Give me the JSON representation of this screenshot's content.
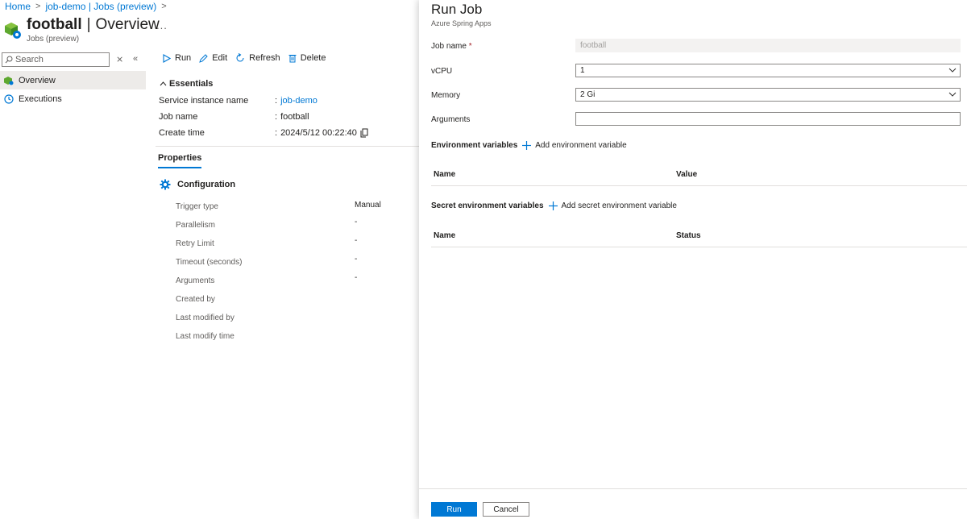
{
  "breadcrumb": {
    "home": "Home",
    "parent": "job-demo | Jobs (preview)"
  },
  "title": {
    "name": "football",
    "section": "Overview",
    "caption": "Jobs (preview)",
    "more": "..."
  },
  "sidebar": {
    "search_placeholder": "Search",
    "items": [
      {
        "label": "Overview",
        "icon": "overview-icon",
        "active": true
      },
      {
        "label": "Executions",
        "icon": "clock-icon",
        "active": false
      }
    ]
  },
  "toolbar": {
    "run": "Run",
    "edit": "Edit",
    "refresh": "Refresh",
    "delete": "Delete"
  },
  "essentials": {
    "header": "Essentials",
    "rows": [
      {
        "label": "Service instance name",
        "value": "job-demo"
      },
      {
        "label": "Job name",
        "value": "football"
      },
      {
        "label": "Create time",
        "value": "2024/5/12 00:22:40"
      }
    ]
  },
  "properties": {
    "tab": "Properties",
    "config_header": "Configuration",
    "rows": [
      {
        "label": "Trigger type",
        "value": "Manual"
      },
      {
        "label": "Parallelism",
        "value": "-"
      },
      {
        "label": "Retry Limit",
        "value": "-"
      },
      {
        "label": "Timeout (seconds)",
        "value": "-"
      },
      {
        "label": "Arguments",
        "value": "-"
      },
      {
        "label": "Created by",
        "value": ""
      },
      {
        "label": "Last modified by",
        "value": ""
      },
      {
        "label": "Last modify time",
        "value": ""
      }
    ]
  },
  "run_job": {
    "title": "Run Job",
    "subtitle": "Azure Spring Apps",
    "fields": {
      "job_name_label": "Job name",
      "job_name_required": "*",
      "job_name_value": "football",
      "vcpu_label": "vCPU",
      "vcpu_value": "1",
      "memory_label": "Memory",
      "memory_value": "2 Gi",
      "arguments_label": "Arguments",
      "arguments_value": ""
    },
    "env": {
      "header": "Environment variables",
      "add": "Add environment variable",
      "col_name": "Name",
      "col_value": "Value"
    },
    "secret_env": {
      "header": "Secret environment variables",
      "add": "Add secret environment variable",
      "col_name": "Name",
      "col_status": "Status"
    },
    "footer": {
      "run": "Run",
      "cancel": "Cancel"
    }
  },
  "colors": {
    "accent": "#0078d4",
    "required": "#a4262c"
  }
}
